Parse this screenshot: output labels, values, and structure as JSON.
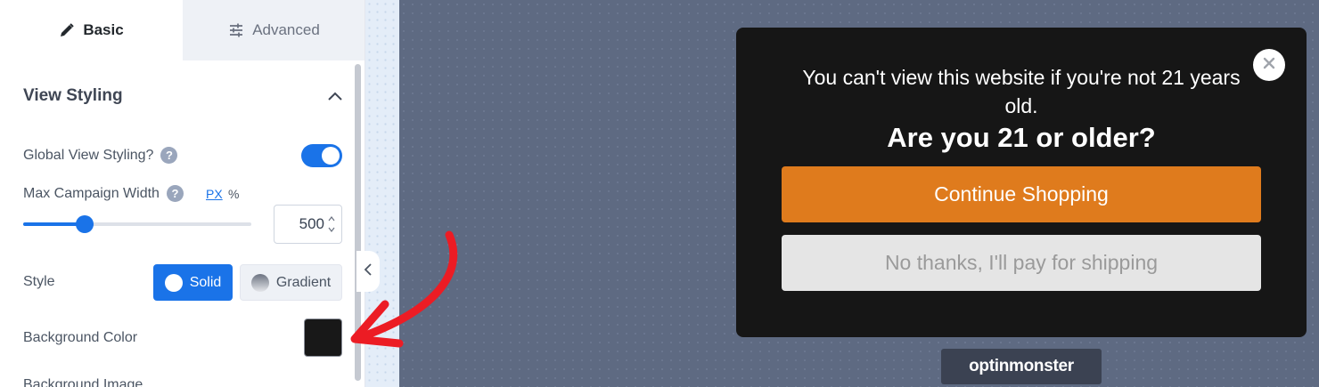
{
  "tabs": [
    {
      "label": "Basic",
      "icon": "pencil-icon",
      "active": true
    },
    {
      "label": "Advanced",
      "icon": "sliders-icon",
      "active": false
    }
  ],
  "section": {
    "title": "View Styling"
  },
  "settings": {
    "global_view_styling": {
      "label": "Global View Styling?",
      "enabled": true
    },
    "max_campaign_width": {
      "label": "Max Campaign Width",
      "unit_px": "PX",
      "unit_percent": "%",
      "value": "500",
      "slider_fraction": 0.27
    },
    "style": {
      "label": "Style",
      "options": [
        "Solid",
        "Gradient"
      ],
      "selected": "Solid"
    },
    "background_color": {
      "label": "Background Color",
      "value": "#181818"
    },
    "background_image": {
      "label": "Background Image"
    }
  },
  "popup": {
    "text": "You can't view this website if you're not 21 years old.",
    "heading": "Are you 21 or older?",
    "continue_label": "Continue Shopping",
    "decline_label": "No thanks, I'll pay for shipping"
  },
  "brand": {
    "label": "optinmonster"
  },
  "colors": {
    "accent": "#1a73e8",
    "popup_bg": "#161616",
    "continue_btn": "#df7b1d",
    "annotation_arrow": "#ec1c24"
  }
}
